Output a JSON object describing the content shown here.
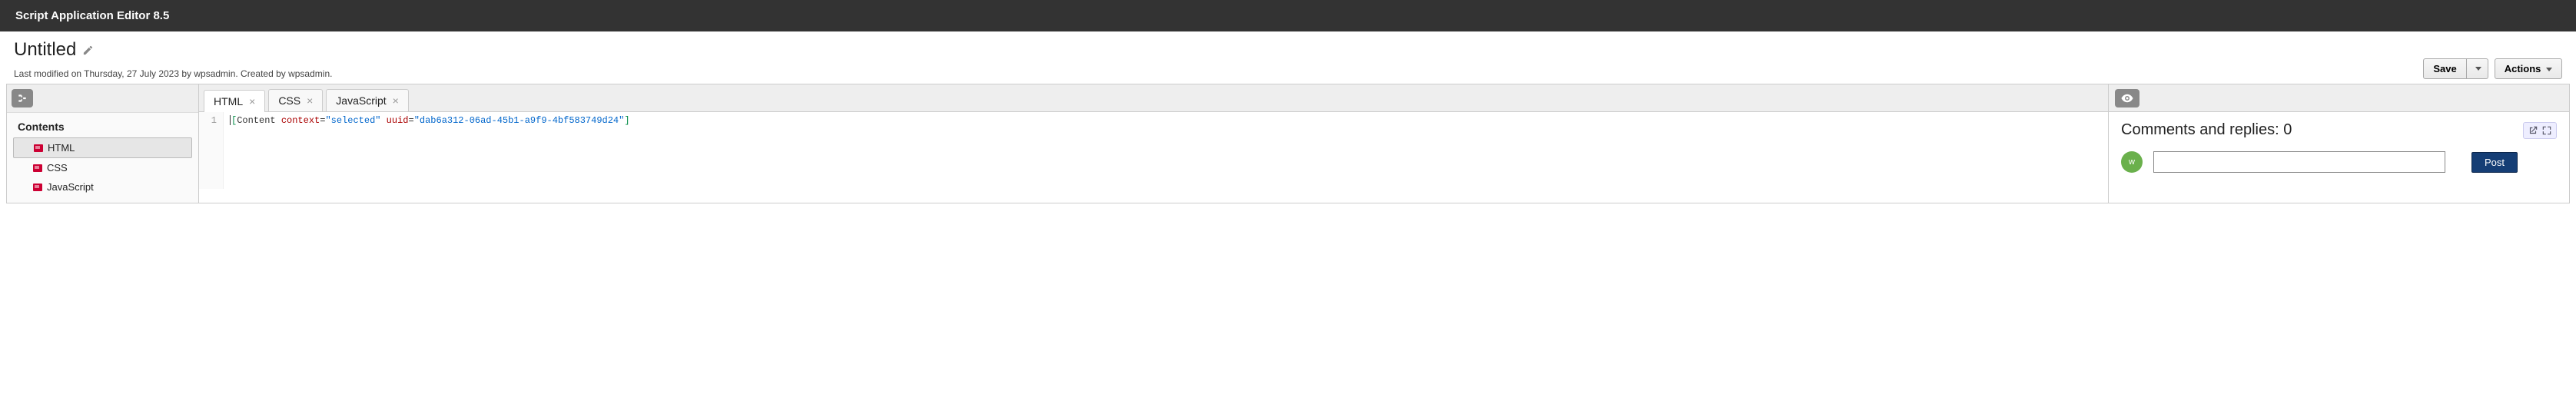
{
  "app": {
    "title": "Script Application Editor 8.5"
  },
  "document": {
    "title": "Untitled",
    "meta": "Last modified on Thursday, 27 July 2023 by wpsadmin. Created by wpsadmin."
  },
  "toolbar": {
    "save_label": "Save",
    "actions_label": "Actions"
  },
  "sidebar": {
    "header": "Contents",
    "items": [
      {
        "label": "HTML"
      },
      {
        "label": "CSS"
      },
      {
        "label": "JavaScript"
      }
    ]
  },
  "tabs": [
    {
      "label": "HTML"
    },
    {
      "label": "CSS"
    },
    {
      "label": "JavaScript"
    }
  ],
  "editor": {
    "line_number": "1",
    "code_open": "[",
    "code_tag": "Content",
    "code_attr1_name": "context",
    "code_attr1_eq": "=",
    "code_attr1_val": "\"selected\"",
    "code_attr2_name": "uuid",
    "code_attr2_eq": "=",
    "code_attr2_val": "\"dab6a312-06ad-45b1-a9f9-4bf583749d24\"",
    "code_close": "]"
  },
  "comments": {
    "title": "Comments and replies: 0",
    "avatar_initial": "w",
    "post_label": "Post",
    "input_value": ""
  }
}
